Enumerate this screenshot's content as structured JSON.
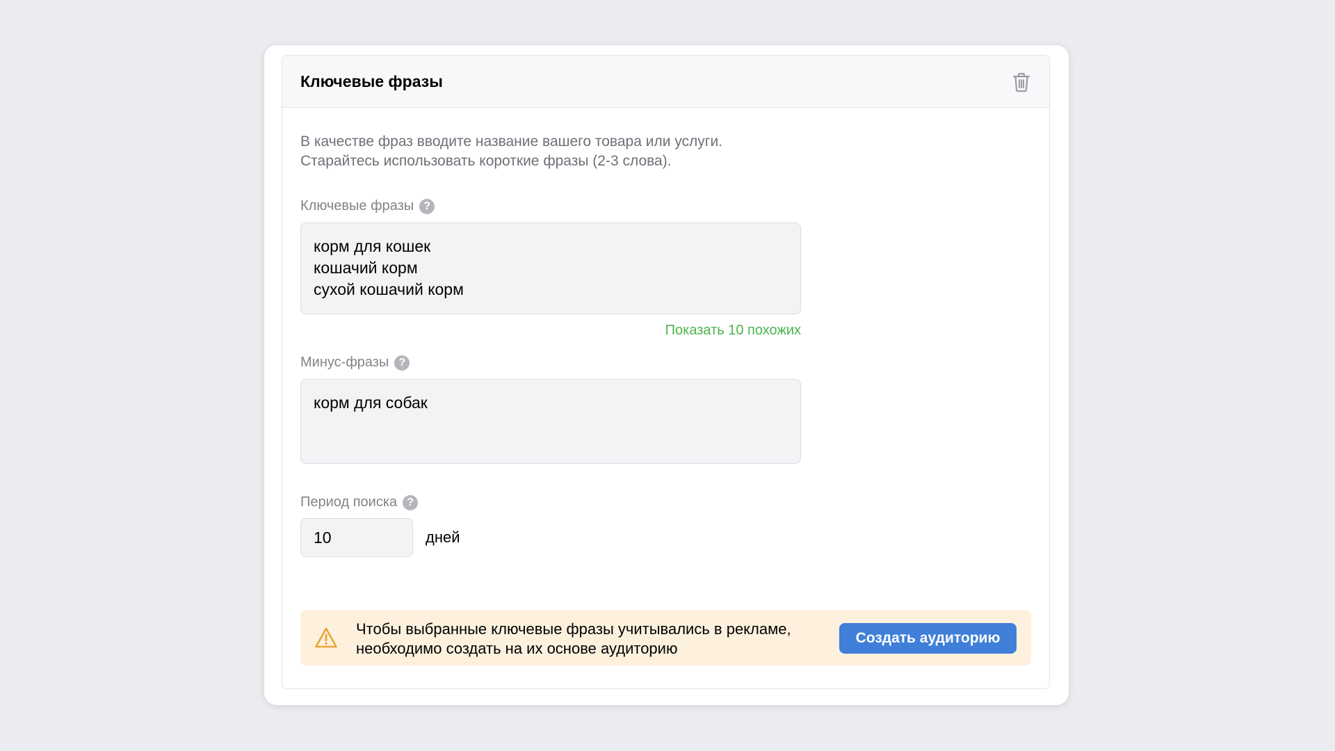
{
  "panel": {
    "title": "Ключевые фразы",
    "delete_icon": "trash-icon"
  },
  "description": {
    "line1": "В качестве фраз вводите название вашего товара или услуги.",
    "line2": "Старайтесь использовать короткие фразы (2-3 слова)."
  },
  "keywords": {
    "label": "Ключевые фразы",
    "help_icon": "question-icon",
    "help_glyph": "?",
    "lines": [
      "корм для кошек",
      "кошачий корм",
      "сухой кошачий корм"
    ],
    "show_similar": "Показать 10 похожих"
  },
  "minus": {
    "label": "Минус-фразы",
    "help_glyph": "?",
    "lines": [
      "корм для собак"
    ]
  },
  "period": {
    "label": "Период поиска",
    "help_glyph": "?",
    "value": "10",
    "unit": "дней"
  },
  "alert": {
    "icon": "warning-icon",
    "line1": "Чтобы выбранные ключевые фразы учитывались в рекламе,",
    "line2": "необходимо создать на их основе аудиторию",
    "button_label": "Создать аудиторию"
  },
  "colors": {
    "background": "#ebecf0",
    "link_green": "#4bb34b",
    "button_blue": "#3f7fd9",
    "warning_bg": "#fdf1dd",
    "warning_icon": "#e8a63a"
  }
}
